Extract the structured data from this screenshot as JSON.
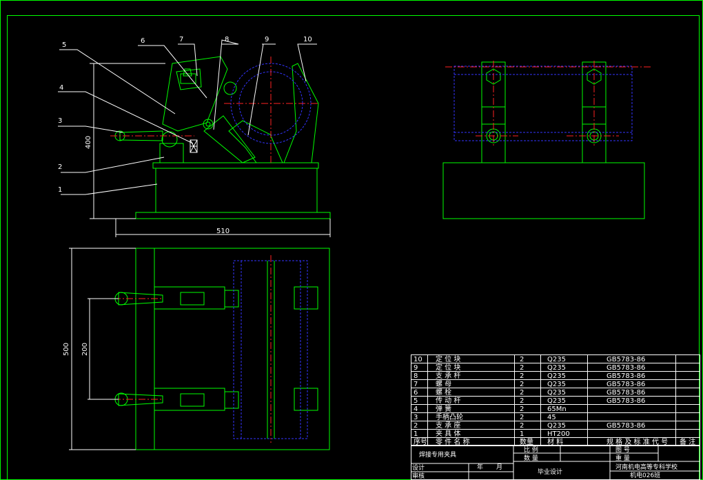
{
  "drawing": {
    "callouts": [
      "1",
      "2",
      "3",
      "4",
      "5",
      "6",
      "7",
      "8",
      "9",
      "10"
    ],
    "dimensions": {
      "height_front": "400",
      "width_front": "510",
      "length_top": "500",
      "spacing_top": "200"
    }
  },
  "bom": {
    "rows": [
      {
        "no": "10",
        "name": "定 位 块",
        "qty": "2",
        "material": "Q235",
        "std": "GB5783-86",
        "note": ""
      },
      {
        "no": "9",
        "name": "定 位 块",
        "qty": "2",
        "material": "Q235",
        "std": "GB5783-86",
        "note": ""
      },
      {
        "no": "8",
        "name": "支 承 杆",
        "qty": "2",
        "material": "Q235",
        "std": "GB5783-86",
        "note": ""
      },
      {
        "no": "7",
        "name": "螺   母",
        "qty": "2",
        "material": "Q235",
        "std": "GB5783-86",
        "note": ""
      },
      {
        "no": "6",
        "name": "螺   栓",
        "qty": "2",
        "material": "Q235",
        "std": "GB5783-86",
        "note": ""
      },
      {
        "no": "5",
        "name": "传 动 杆",
        "qty": "2",
        "material": "Q235",
        "std": "GB5783-86",
        "note": ""
      },
      {
        "no": "4",
        "name": "弹   簧",
        "qty": "2",
        "material": "65Mn",
        "std": "",
        "note": ""
      },
      {
        "no": "3",
        "name": "手柄凸轮",
        "qty": "2",
        "material": "45",
        "std": "",
        "note": ""
      },
      {
        "no": "2",
        "name": "支 承 座",
        "qty": "2",
        "material": "Q235",
        "std": "GB5783-86",
        "note": ""
      },
      {
        "no": "1",
        "name": "夹 具 体",
        "qty": "1",
        "material": "HT200",
        "std": "",
        "note": ""
      }
    ],
    "header": {
      "no": "序号",
      "name": "零 件 名 称",
      "qty": "数量",
      "material": "材   料",
      "std": "规 格 及 标 准 代 号",
      "note": "备 注"
    }
  },
  "title_block": {
    "part_name": "焊接专用夹具",
    "scale_label": "比   例",
    "quantity_label": "数   量",
    "sheet_label": "图   号",
    "weight_label": "重   量",
    "designer_label": "设计",
    "reviewer_label": "审核",
    "year_label": "年",
    "month_label": "月",
    "thesis_label": "毕业设计",
    "school": "河南机电高等专科学校",
    "class_name": "机电026班"
  },
  "colors": {
    "outline": "#00ff00",
    "hidden": "#3333ff",
    "center": "#ff2222",
    "leader": "#ffffff",
    "text": "#ffffff",
    "spring": "#ffffff"
  }
}
